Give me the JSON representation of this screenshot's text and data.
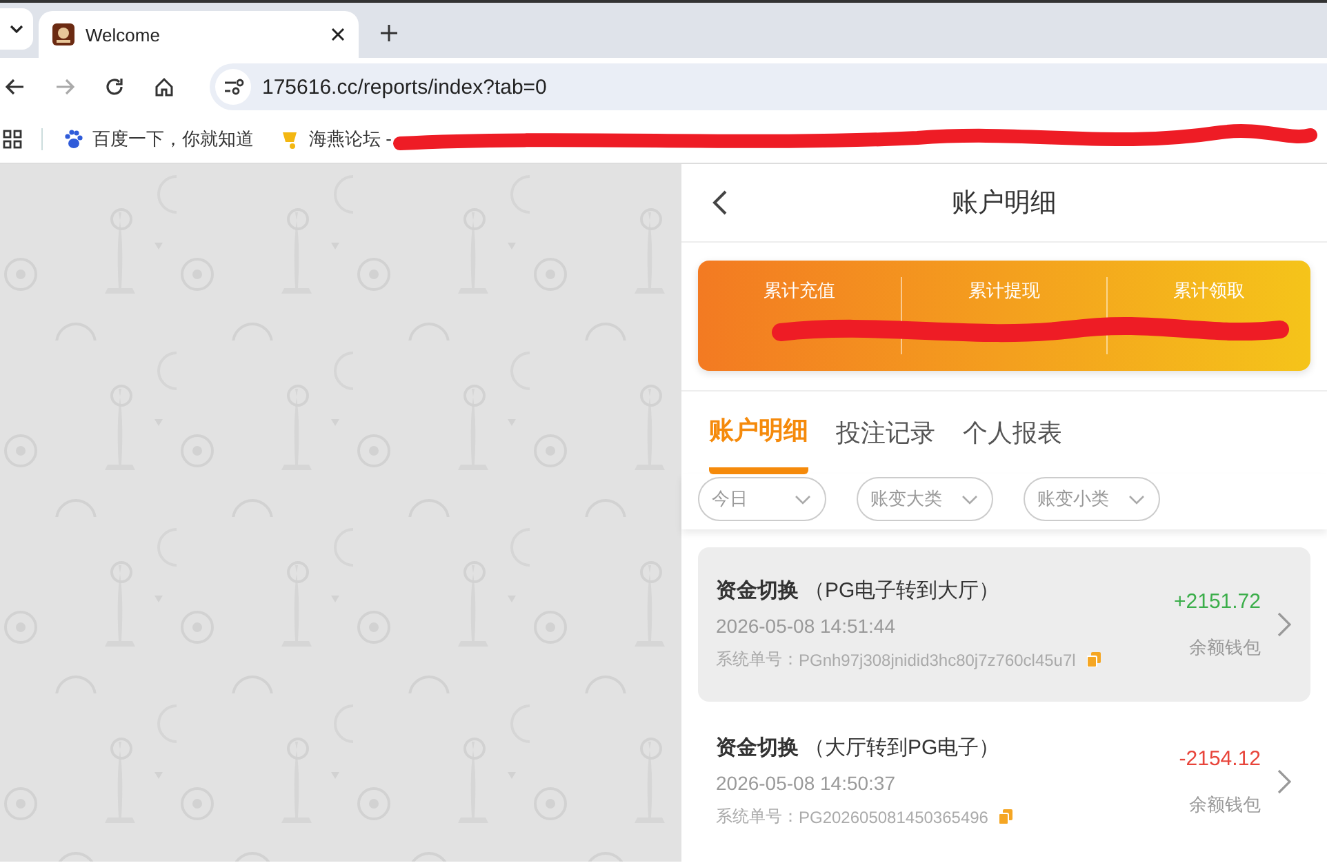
{
  "browser": {
    "tab": {
      "title": "Welcome"
    },
    "url": "175616.cc/reports/index?tab=0",
    "bookmarks": [
      {
        "label": "百度一下，你就知道",
        "kind": "paw"
      },
      {
        "label": "海燕论坛 -",
        "kind": "bell"
      }
    ]
  },
  "header": {
    "title": "账户明细"
  },
  "summary": [
    {
      "label": "累计充值"
    },
    {
      "label": "累计提现"
    },
    {
      "label": "累计领取"
    }
  ],
  "tabs": [
    {
      "label": "账户明细",
      "selected": true
    },
    {
      "label": "投注记录",
      "selected": false
    },
    {
      "label": "个人报表",
      "selected": false
    }
  ],
  "filters": [
    {
      "label": "今日"
    },
    {
      "label": "账变大类"
    },
    {
      "label": "账变小类"
    }
  ],
  "records": [
    {
      "title": "资金切换",
      "detail": "（PG电子转到大厅）",
      "time": "2026-05-08 14:51:44",
      "order_label": "系统单号：",
      "order_no": "PGnh97j308jnidid3hc80j7z760cl45u7l",
      "amount": "+2151.72",
      "kind": "credit",
      "wallet": "余额钱包",
      "selected": true
    },
    {
      "title": "资金切换",
      "detail": "（大厅转到PG电子）",
      "time": "2026-05-08 14:50:37",
      "order_label": "系统单号：",
      "order_no": "PG202605081450365496",
      "amount": "-2154.12",
      "kind": "debit",
      "wallet": "余额钱包",
      "selected": false
    }
  ]
}
